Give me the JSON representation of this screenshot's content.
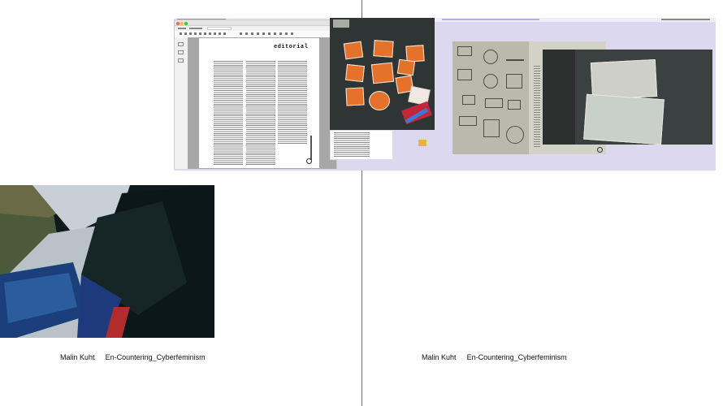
{
  "left_page": {
    "caption_author": "Malin Kuht",
    "caption_title": "En-Countering_Cyberfeminism"
  },
  "right_page": {
    "caption_author": "Malin Kuht",
    "caption_title": "En-Countering_Cyberfeminism",
    "pdf_page_title": "editorial"
  },
  "colors": {
    "desktop": "#dcd8f0",
    "sticker_orange": "#e4722b",
    "spine": "#6b6b6b"
  }
}
